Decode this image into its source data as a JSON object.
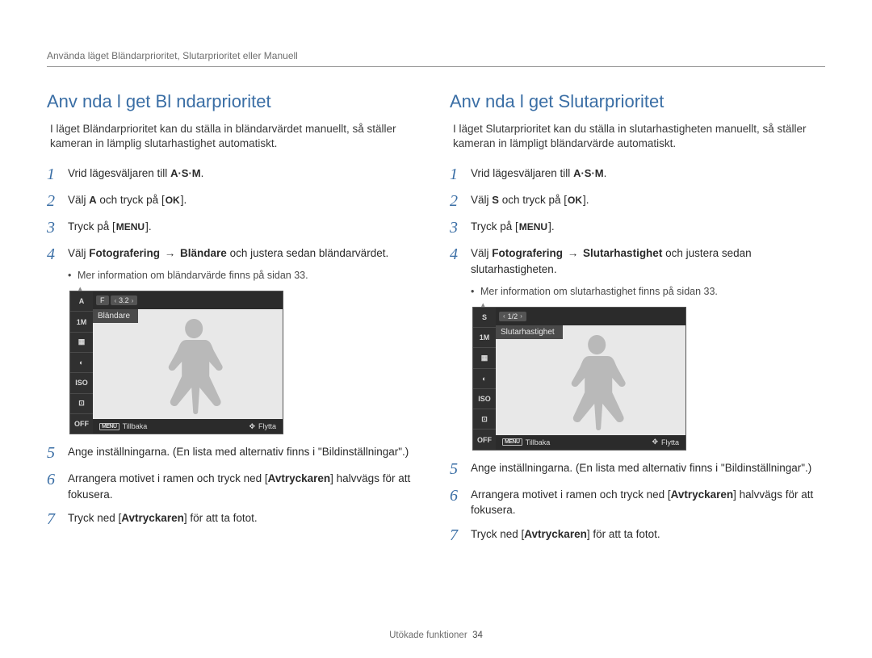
{
  "header_line": "Använda läget Bländarprioritet, Slutarprioritet eller Manuell",
  "left": {
    "title": "Anv nda l get Bl ndarprioritet",
    "intro": "I läget Bländarprioritet kan du ställa in bländarvärdet manuellt, så ställer kameran in lämplig slutarhastighet automatiskt.",
    "steps": {
      "s1_pre": "Vrid lägesväljaren till ",
      "asm": "A·S·M",
      "s2_pre": "Välj ",
      "s2_glyph": "A",
      "s2_mid": " och tryck på [",
      "ok": "OK",
      "s2_post": "].",
      "s3_pre": "Tryck på [",
      "menu": "MENU",
      "s3_post": "].",
      "s4_a": "Välj ",
      "s4_b": "Fotografering",
      "s4_arrow": "→",
      "s4_c": "Bländare",
      "s4_d": " och justera sedan bländarvärdet.",
      "s4_bullet": "Mer information om bländarvärde finns på sidan 33.",
      "s5": "Ange inställningarna. (En lista med alternativ finns i \"Bildinställningar\".)",
      "s6_a": "Arrangera motivet i ramen och tryck ned [",
      "s6_b": "Avtryckaren",
      "s6_c": "] halvvägs för att fokusera.",
      "s7_a": "Tryck ned [",
      "s7_b": "Avtryckaren",
      "s7_c": "] för att ta fotot."
    },
    "lcd": {
      "side0": "A",
      "side1": "1M",
      "side2": "▦",
      "side3": "◐",
      "side4": "ISO",
      "side5": "⊡",
      "side6": "OFF",
      "chip_f": "F",
      "chip_val": "3.2",
      "label": "Bländare",
      "back_label": "Tillbaka",
      "move_label": "Flytta",
      "menu_icon": "MENU"
    }
  },
  "right": {
    "title": "Anv nda l get Slutarprioritet",
    "intro": "I läget Slutarprioritet kan du ställa in slutarhastigheten manuellt, så ställer kameran in lämpligt bländarvärde automatiskt.",
    "steps": {
      "s1_pre": "Vrid lägesväljaren till ",
      "asm": "A·S·M",
      "s2_pre": "Välj ",
      "s2_glyph": "S",
      "s2_mid": " och tryck på [",
      "ok": "OK",
      "s2_post": "].",
      "s3_pre": "Tryck på [",
      "menu": "MENU",
      "s3_post": "].",
      "s4_a": "Välj ",
      "s4_b": "Fotografering",
      "s4_arrow": "→",
      "s4_c": "Slutarhastighet",
      "s4_d": " och justera sedan slutarhastigheten.",
      "s4_bullet": "Mer information om slutarhastighet finns på sidan 33.",
      "s5": "Ange inställningarna. (En lista med alternativ finns i \"Bildinställningar\".)",
      "s6_a": "Arrangera motivet i ramen och tryck ned [",
      "s6_b": "Avtryckaren",
      "s6_c": "] halvvägs för att fokusera.",
      "s7_a": "Tryck ned [",
      "s7_b": "Avtryckaren",
      "s7_c": "] för att ta fotot."
    },
    "lcd": {
      "side0": "S",
      "side1": "1M",
      "side2": "▦",
      "side3": "◐",
      "side4": "ISO",
      "side5": "⊡",
      "side6": "OFF",
      "chip_f": "",
      "chip_val": "1/2",
      "label": "Slutarhastighet",
      "back_label": "Tillbaka",
      "move_label": "Flytta",
      "menu_icon": "MENU"
    }
  },
  "footer": {
    "text": "Utökade funktioner",
    "page": "34"
  }
}
